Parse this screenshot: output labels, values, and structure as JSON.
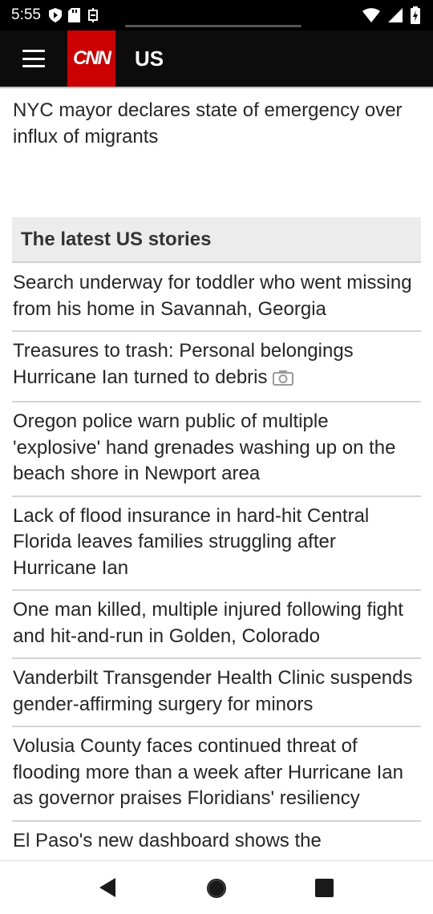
{
  "status_bar": {
    "time": "5:55"
  },
  "header": {
    "logo_text": "CNN",
    "section": "US"
  },
  "lead_headline": "NYC mayor declares state of emergency over influx of migrants",
  "section_header": "The latest US stories",
  "stories": [
    {
      "title": "Search underway for toddler who went missing from his home in Savannah, Georgia"
    },
    {
      "title": "Treasures to trash: Personal belongings Hurricane Ian turned to debris",
      "icon": "camera-icon"
    },
    {
      "title": "Oregon police warn public of multiple 'explosive' hand grenades washing up on the beach shore in Newport area"
    },
    {
      "title": "Lack of flood insurance in hard-hit Central Florida leaves families struggling after Hurricane Ian"
    },
    {
      "title": "One man killed, multiple injured following fight and hit-and-run in Golden, Colorado"
    },
    {
      "title": "Vanderbilt Transgender Health Clinic suspends gender-affirming surgery for minors"
    },
    {
      "title": "Volusia County faces continued threat of flooding more than a week after Hurricane Ian as governor praises Floridians' resiliency"
    },
    {
      "title": "El Paso's new dashboard shows the"
    }
  ],
  "colors": {
    "brand_red": "#cc0000",
    "header_bg": "#0c0c0c",
    "section_bg": "#ececec"
  }
}
